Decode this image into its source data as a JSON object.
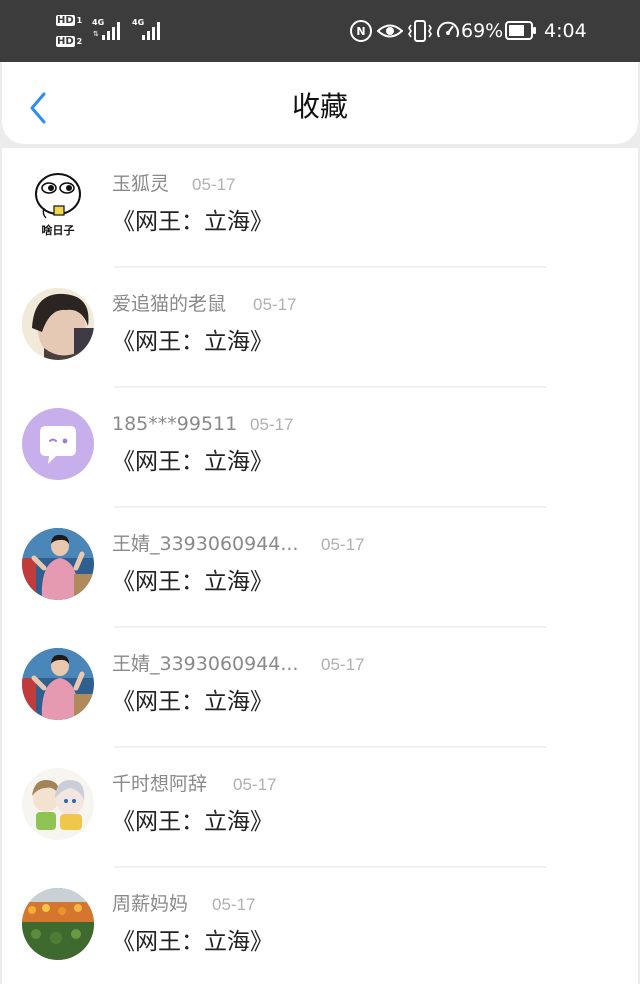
{
  "status_bar": {
    "hd_label": "HD",
    "sim1_index": "1",
    "sim2_index": "2",
    "network1": "4G",
    "network2": "4G",
    "battery_percent": "69%",
    "time": "4:04",
    "icons": [
      "hd-icon",
      "signal-icon",
      "nfc-icon",
      "eye-icon",
      "vibrate-icon",
      "speed-icon",
      "battery-icon"
    ]
  },
  "header": {
    "back_icon": "chevron-left-icon",
    "title": "收藏",
    "accent_color": "#2d8cf0"
  },
  "favorites": [
    {
      "user": "玉狐灵",
      "date": "05-17",
      "title": "《网王：立海》",
      "avatar_caption": "啥日子"
    },
    {
      "user": "爱追猫的老鼠",
      "date": "05-17",
      "title": "《网王：立海》"
    },
    {
      "user": "185***99511",
      "date": "05-17",
      "title": "《网王：立海》"
    },
    {
      "user": "王婧_3393060944...",
      "date": "05-17",
      "title": "《网王：立海》"
    },
    {
      "user": "王婧_3393060944...",
      "date": "05-17",
      "title": "《网王：立海》"
    },
    {
      "user": "千时想阿辞",
      "date": "05-17",
      "title": "《网王：立海》"
    },
    {
      "user": "周薪妈妈",
      "date": "05-17",
      "title": "《网王：立海》"
    }
  ]
}
